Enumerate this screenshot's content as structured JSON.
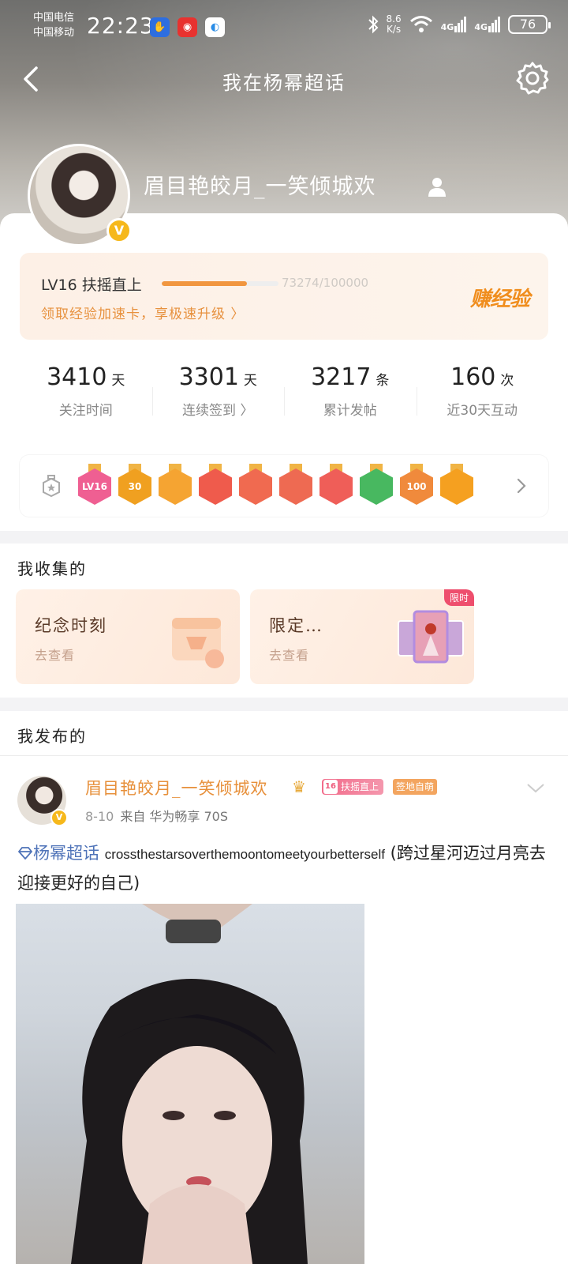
{
  "status_bar": {
    "carrier1": "中国电信",
    "carrier2": "中国移动",
    "time": "22:23",
    "speed_value": "8.6",
    "speed_unit": "K/s",
    "network1": "4G",
    "network2": "4G",
    "battery": "76"
  },
  "nav": {
    "title": "我在杨幂超话"
  },
  "profile": {
    "username": "眉目艳皎月_一笑倾城欢"
  },
  "level": {
    "label": "LV16 扶摇直上",
    "exp": "73274/100000",
    "progress": 0.733,
    "boost_link": "领取经验加速卡，享极速升级 〉",
    "earn_button": "赚经验"
  },
  "stats": [
    {
      "value": "3410",
      "unit": "天",
      "label": "关注时间"
    },
    {
      "value": "3301",
      "unit": "天",
      "label": "连续签到 〉"
    },
    {
      "value": "3217",
      "unit": "条",
      "label": "累计发帖"
    },
    {
      "value": "160",
      "unit": "次",
      "label": "近30天互动"
    }
  ],
  "badges": [
    {
      "icon": "lv16-badge",
      "text": "LV16",
      "color": "#ef5f92"
    },
    {
      "icon": "30-days-badge",
      "text": "30",
      "color": "#f0a020"
    },
    {
      "icon": "crown-badge",
      "text": "",
      "color": "#f5a432"
    },
    {
      "icon": "cat-badge",
      "text": "",
      "color": "#ef5b4c"
    },
    {
      "icon": "tiger-badge",
      "text": "",
      "color": "#f06a50"
    },
    {
      "icon": "rabbit-badge",
      "text": "",
      "color": "#ee6a52"
    },
    {
      "icon": "bunny-badge",
      "text": "",
      "color": "#ef5e58"
    },
    {
      "icon": "cactus-badge",
      "text": "",
      "color": "#48b860"
    },
    {
      "icon": "100-badge",
      "text": "100",
      "color": "#f08a3c"
    },
    {
      "icon": "emoji-badge",
      "text": "",
      "color": "#f5a020"
    }
  ],
  "collection": {
    "title": "我收集的",
    "items": [
      {
        "title": "纪念时刻",
        "subtitle": "去查看"
      },
      {
        "title": "限定…",
        "subtitle": "去查看",
        "tag": "限时"
      }
    ]
  },
  "posts": {
    "title": "我发布的",
    "post": {
      "author": "眉目艳皎月_一笑倾城欢",
      "level_num": "16",
      "level_tag": "扶摇直上",
      "sign_tag": "签地自萌",
      "date": "8-10",
      "source": "来自 华为畅享 70S",
      "topic": "杨幂超话",
      "text_en": "crossthestarsoverthemoontomeetyourbetterself",
      "text_cn": " (跨过星河迈过月亮去迎接更好的自己)"
    }
  },
  "colors": {
    "accent": "#e7903b",
    "progress": "#f1963f",
    "topic": "#4f73b8"
  }
}
